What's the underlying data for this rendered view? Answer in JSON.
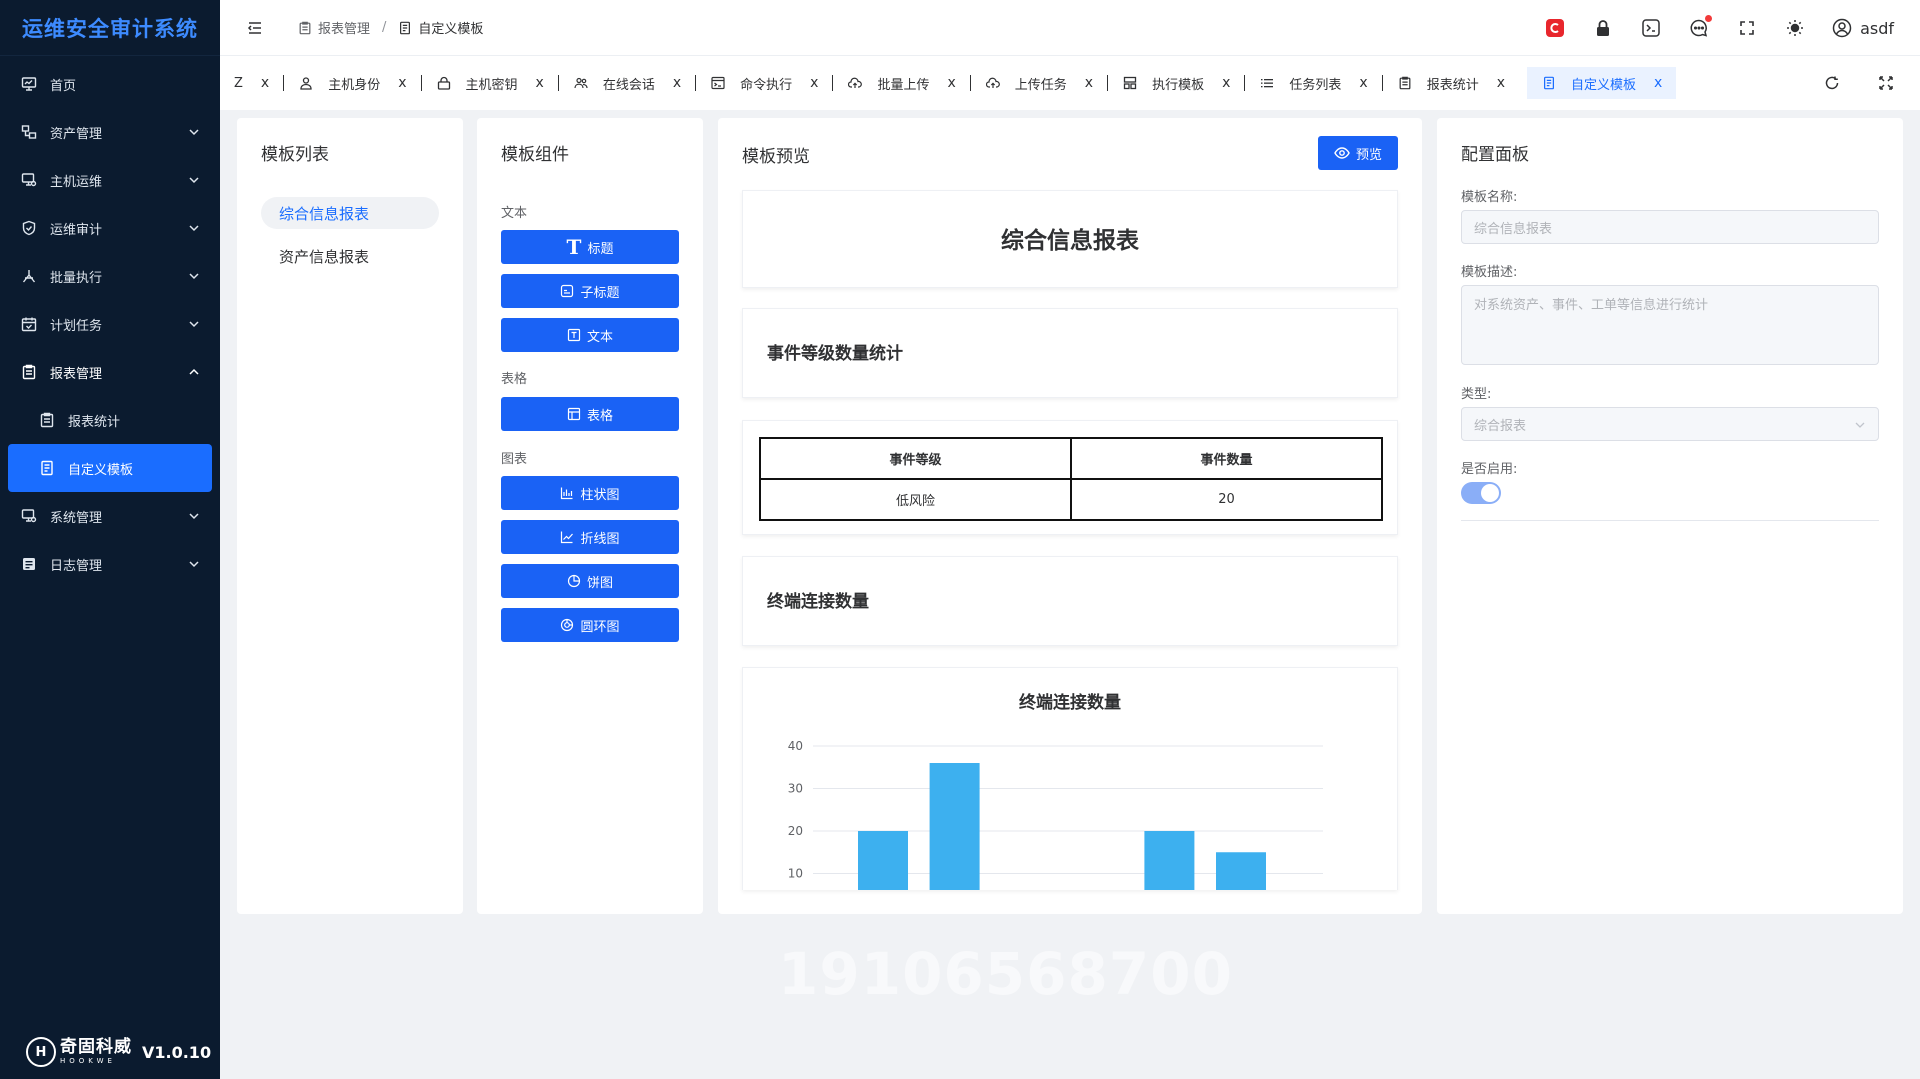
{
  "app": {
    "title": "运维安全审计系统",
    "version": "V1.0.10",
    "logo_text": "奇固科威",
    "logo_en": "HOOKWE"
  },
  "sidebar": {
    "items": [
      {
        "label": "首页",
        "icon": "dashboard-icon"
      },
      {
        "label": "资产管理",
        "icon": "asset-icon"
      },
      {
        "label": "主机运维",
        "icon": "host-icon"
      },
      {
        "label": "运维审计",
        "icon": "shield-icon"
      },
      {
        "label": "批量执行",
        "icon": "batch-icon"
      },
      {
        "label": "计划任务",
        "icon": "calendar-icon"
      },
      {
        "label": "报表管理",
        "icon": "report-icon"
      },
      {
        "label": "报表统计",
        "icon": "report-stat-icon"
      },
      {
        "label": "自定义模板",
        "icon": "template-icon"
      },
      {
        "label": "系统管理",
        "icon": "system-icon"
      },
      {
        "label": "日志管理",
        "icon": "log-icon"
      }
    ]
  },
  "header": {
    "breadcrumb": [
      "报表管理",
      "自定义模板"
    ],
    "separator": "/",
    "username": "asdf"
  },
  "tabs": {
    "items": [
      {
        "label": "主机身份"
      },
      {
        "label": "主机密钥"
      },
      {
        "label": "在线会话"
      },
      {
        "label": "命令执行"
      },
      {
        "label": "批量上传"
      },
      {
        "label": "上传任务"
      },
      {
        "label": "执行模板"
      },
      {
        "label": "任务列表"
      },
      {
        "label": "报表统计"
      },
      {
        "label": "自定义模板"
      }
    ],
    "close": "x",
    "truncated_fragment": "Z"
  },
  "template_list": {
    "title": "模板列表",
    "items": [
      "综合信息报表",
      "资产信息报表"
    ]
  },
  "components": {
    "title": "模板组件",
    "groups": [
      {
        "label": "文本",
        "buttons": [
          "标题",
          "子标题",
          "文本"
        ]
      },
      {
        "label": "表格",
        "buttons": [
          "表格"
        ]
      },
      {
        "label": "图表",
        "buttons": [
          "柱状图",
          "折线图",
          "饼图",
          "圆环图"
        ]
      }
    ]
  },
  "preview": {
    "title": "模板预览",
    "button": "预览",
    "report_title": "综合信息报表",
    "section1": "事件等级数量统计",
    "table": {
      "headers": [
        "事件等级",
        "事件数量"
      ],
      "rows": [
        [
          "低风险",
          "20"
        ]
      ]
    },
    "section2": "终端连接数量"
  },
  "chart_data": {
    "type": "bar",
    "title": "终端连接数量",
    "values": [
      20,
      36,
      4,
      4,
      20,
      15
    ],
    "y_ticks": [
      10,
      20,
      30,
      40
    ],
    "ylim": [
      0,
      40
    ],
    "color": "#3db0ef",
    "grid": true
  },
  "config": {
    "title": "配置面板",
    "name_label": "模板名称:",
    "name_value": "综合信息报表",
    "desc_label": "模板描述:",
    "desc_value": "对系统资产、事件、工单等信息进行统计",
    "type_label": "类型:",
    "type_value": "综合报表",
    "enabled_label": "是否启用:",
    "enabled": true
  },
  "watermark": "19106568700",
  "colors": {
    "primary": "#1a62f5",
    "sidebar_bg": "#0b1b2f",
    "brand": "#3d8bff"
  }
}
